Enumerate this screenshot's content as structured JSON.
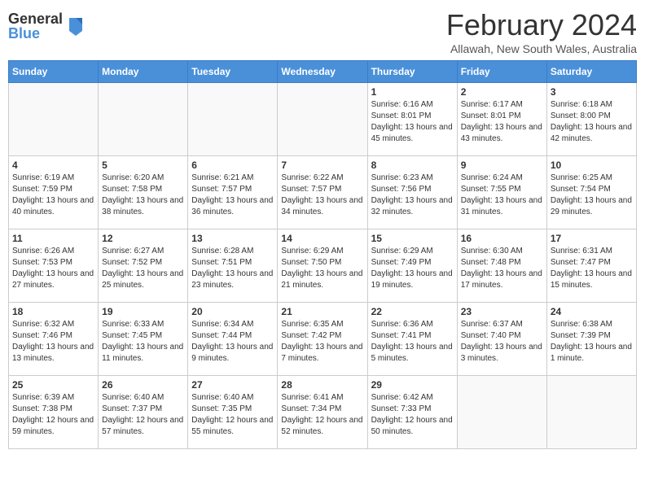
{
  "logo": {
    "general": "General",
    "blue": "Blue"
  },
  "title": "February 2024",
  "subtitle": "Allawah, New South Wales, Australia",
  "days_of_week": [
    "Sunday",
    "Monday",
    "Tuesday",
    "Wednesday",
    "Thursday",
    "Friday",
    "Saturday"
  ],
  "weeks": [
    [
      {
        "day": "",
        "info": ""
      },
      {
        "day": "",
        "info": ""
      },
      {
        "day": "",
        "info": ""
      },
      {
        "day": "",
        "info": ""
      },
      {
        "day": "1",
        "info": "Sunrise: 6:16 AM\nSunset: 8:01 PM\nDaylight: 13 hours and 45 minutes."
      },
      {
        "day": "2",
        "info": "Sunrise: 6:17 AM\nSunset: 8:01 PM\nDaylight: 13 hours and 43 minutes."
      },
      {
        "day": "3",
        "info": "Sunrise: 6:18 AM\nSunset: 8:00 PM\nDaylight: 13 hours and 42 minutes."
      }
    ],
    [
      {
        "day": "4",
        "info": "Sunrise: 6:19 AM\nSunset: 7:59 PM\nDaylight: 13 hours and 40 minutes."
      },
      {
        "day": "5",
        "info": "Sunrise: 6:20 AM\nSunset: 7:58 PM\nDaylight: 13 hours and 38 minutes."
      },
      {
        "day": "6",
        "info": "Sunrise: 6:21 AM\nSunset: 7:57 PM\nDaylight: 13 hours and 36 minutes."
      },
      {
        "day": "7",
        "info": "Sunrise: 6:22 AM\nSunset: 7:57 PM\nDaylight: 13 hours and 34 minutes."
      },
      {
        "day": "8",
        "info": "Sunrise: 6:23 AM\nSunset: 7:56 PM\nDaylight: 13 hours and 32 minutes."
      },
      {
        "day": "9",
        "info": "Sunrise: 6:24 AM\nSunset: 7:55 PM\nDaylight: 13 hours and 31 minutes."
      },
      {
        "day": "10",
        "info": "Sunrise: 6:25 AM\nSunset: 7:54 PM\nDaylight: 13 hours and 29 minutes."
      }
    ],
    [
      {
        "day": "11",
        "info": "Sunrise: 6:26 AM\nSunset: 7:53 PM\nDaylight: 13 hours and 27 minutes."
      },
      {
        "day": "12",
        "info": "Sunrise: 6:27 AM\nSunset: 7:52 PM\nDaylight: 13 hours and 25 minutes."
      },
      {
        "day": "13",
        "info": "Sunrise: 6:28 AM\nSunset: 7:51 PM\nDaylight: 13 hours and 23 minutes."
      },
      {
        "day": "14",
        "info": "Sunrise: 6:29 AM\nSunset: 7:50 PM\nDaylight: 13 hours and 21 minutes."
      },
      {
        "day": "15",
        "info": "Sunrise: 6:29 AM\nSunset: 7:49 PM\nDaylight: 13 hours and 19 minutes."
      },
      {
        "day": "16",
        "info": "Sunrise: 6:30 AM\nSunset: 7:48 PM\nDaylight: 13 hours and 17 minutes."
      },
      {
        "day": "17",
        "info": "Sunrise: 6:31 AM\nSunset: 7:47 PM\nDaylight: 13 hours and 15 minutes."
      }
    ],
    [
      {
        "day": "18",
        "info": "Sunrise: 6:32 AM\nSunset: 7:46 PM\nDaylight: 13 hours and 13 minutes."
      },
      {
        "day": "19",
        "info": "Sunrise: 6:33 AM\nSunset: 7:45 PM\nDaylight: 13 hours and 11 minutes."
      },
      {
        "day": "20",
        "info": "Sunrise: 6:34 AM\nSunset: 7:44 PM\nDaylight: 13 hours and 9 minutes."
      },
      {
        "day": "21",
        "info": "Sunrise: 6:35 AM\nSunset: 7:42 PM\nDaylight: 13 hours and 7 minutes."
      },
      {
        "day": "22",
        "info": "Sunrise: 6:36 AM\nSunset: 7:41 PM\nDaylight: 13 hours and 5 minutes."
      },
      {
        "day": "23",
        "info": "Sunrise: 6:37 AM\nSunset: 7:40 PM\nDaylight: 13 hours and 3 minutes."
      },
      {
        "day": "24",
        "info": "Sunrise: 6:38 AM\nSunset: 7:39 PM\nDaylight: 13 hours and 1 minute."
      }
    ],
    [
      {
        "day": "25",
        "info": "Sunrise: 6:39 AM\nSunset: 7:38 PM\nDaylight: 12 hours and 59 minutes."
      },
      {
        "day": "26",
        "info": "Sunrise: 6:40 AM\nSunset: 7:37 PM\nDaylight: 12 hours and 57 minutes."
      },
      {
        "day": "27",
        "info": "Sunrise: 6:40 AM\nSunset: 7:35 PM\nDaylight: 12 hours and 55 minutes."
      },
      {
        "day": "28",
        "info": "Sunrise: 6:41 AM\nSunset: 7:34 PM\nDaylight: 12 hours and 52 minutes."
      },
      {
        "day": "29",
        "info": "Sunrise: 6:42 AM\nSunset: 7:33 PM\nDaylight: 12 hours and 50 minutes."
      },
      {
        "day": "",
        "info": ""
      },
      {
        "day": "",
        "info": ""
      }
    ]
  ]
}
